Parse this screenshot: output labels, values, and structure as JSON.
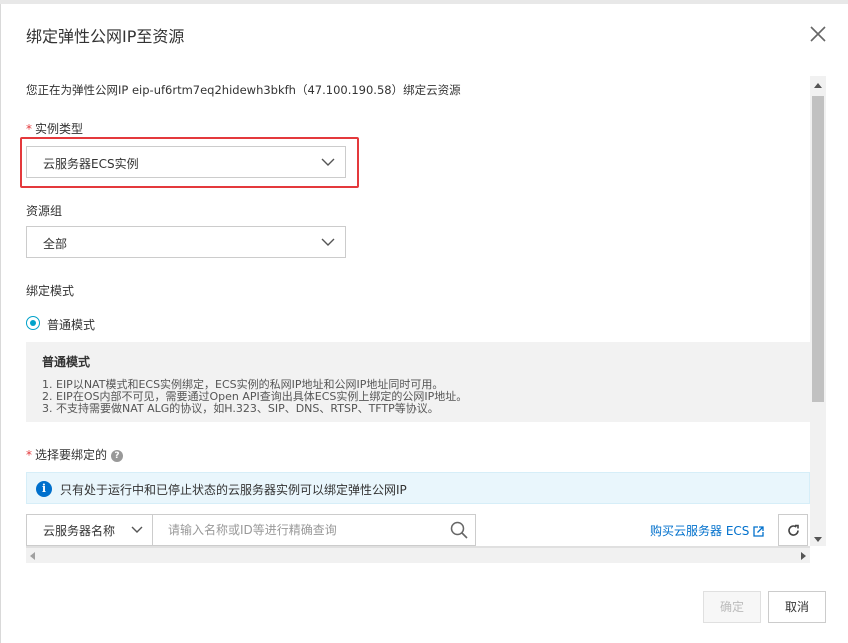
{
  "dialog": {
    "title": "绑定弹性公网IP至资源",
    "intro": "您正在为弹性公网IP eip-uf6rtm7eq2hidewh3bkfh（47.100.190.58）绑定云资源"
  },
  "instance_type": {
    "required_mark": "*",
    "label": "实例类型",
    "value": "云服务器ECS实例"
  },
  "resource_group": {
    "label": "资源组",
    "value": "全部"
  },
  "bind_mode": {
    "label": "绑定模式",
    "option": "普通模式",
    "info_title": "普通模式",
    "info_lines": [
      "1. EIP以NAT模式和ECS实例绑定，ECS实例的私网IP地址和公网IP地址同时可用。",
      "2. EIP在OS内部不可见，需要通过Open API查询出具体ECS实例上绑定的公网IP地址。",
      "3. 不支持需要做NAT ALG的协议，如H.323、SIP、DNS、RTSP、TFTP等协议。"
    ]
  },
  "select_target": {
    "required_mark": "*",
    "label": "选择要绑定的",
    "notice": "只有处于运行中和已停止状态的云服务器实例可以绑定弹性公网IP",
    "search_field": "云服务器名称",
    "search_placeholder": "请输入名称或ID等进行精确查询",
    "buy_link": "购买云服务器 ECS"
  },
  "footer": {
    "ok_label": "确定",
    "cancel_label": "取消"
  },
  "colors": {
    "accent": "#00a2ca",
    "link": "#0070cc",
    "highlight": "#e4393c"
  }
}
